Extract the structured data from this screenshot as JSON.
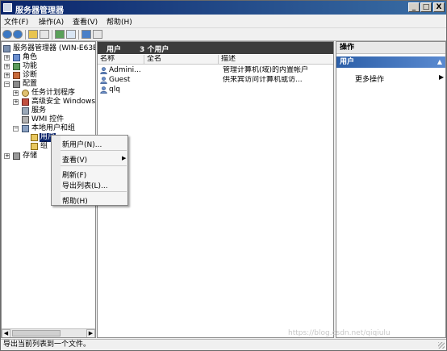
{
  "window": {
    "title": "服务器管理器"
  },
  "window_buttons": [
    "_",
    "□",
    "X"
  ],
  "menubar": {
    "items": [
      "文件(F)",
      "操作(A)",
      "查看(V)",
      "帮助(H)"
    ]
  },
  "tree": {
    "root": "服务器管理器 (WIN-E63E",
    "roles": "角色",
    "features": "功能",
    "diagnostics": "诊断",
    "config": "配置",
    "task_scheduler": "任务计划程序",
    "firewall": "高级安全 Windows",
    "services": "服务",
    "wmi": "WMI 控件",
    "local_users": "本地用户和组",
    "users": "用户",
    "groups": "组",
    "storage": "存储"
  },
  "center": {
    "header_title": "用户",
    "header_count": "3 个用户",
    "columns": [
      "名称",
      "全名",
      "描述"
    ],
    "rows": [
      {
        "name": "Admini...",
        "fullname": "",
        "desc": "管理计算机(域)的内置帐户"
      },
      {
        "name": "Guest",
        "fullname": "",
        "desc": "供来宾访问计算机或访..."
      },
      {
        "name": "qlq",
        "fullname": "",
        "desc": ""
      }
    ]
  },
  "actions": {
    "header": "操作",
    "section": "用户",
    "more": "更多操作"
  },
  "context_menu": {
    "new_user": "新用户(N)...",
    "view": "查看(V)",
    "refresh": "刷新(F)",
    "export": "导出列表(L)...",
    "help": "帮助(H)"
  },
  "statusbar": {
    "text": "导出当前列表到一个文件。"
  },
  "watermark": "https://blog.csdn.net/qiqiulu"
}
